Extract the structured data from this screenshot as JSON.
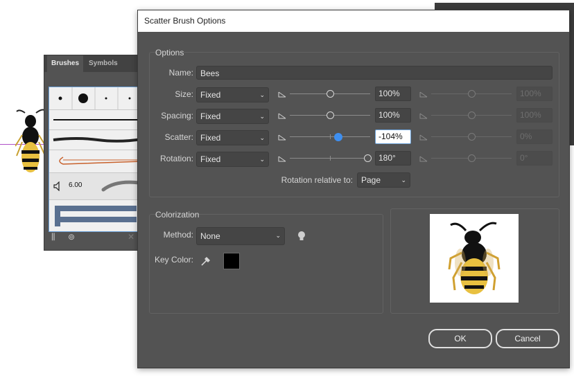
{
  "background": {
    "brushes_panel": {
      "tabs": [
        "Brushes",
        "Symbols"
      ],
      "stroke_weight": "6.00"
    }
  },
  "dialog": {
    "title": "Scatter Brush Options",
    "options_group": "Options",
    "name_label": "Name:",
    "name_value": "Bees",
    "rows": [
      {
        "label": "Size:",
        "method": "Fixed",
        "value": "100%",
        "value2": "100%",
        "slider_fraction": 0.5,
        "value2_dim": true
      },
      {
        "label": "Spacing:",
        "method": "Fixed",
        "value": "100%",
        "value2": "100%",
        "slider_fraction": 0.5,
        "value2_dim": true
      },
      {
        "label": "Scatter:",
        "method": "Fixed",
        "value": "-104%",
        "value2": "0%",
        "slider_fraction": 0.6,
        "value2_dim": true
      },
      {
        "label": "Rotation:",
        "method": "Fixed",
        "value": "180°",
        "value2": "0°",
        "slider_fraction": 1.0,
        "value2_dim": true
      }
    ],
    "rotation_relative_label": "Rotation relative to:",
    "rotation_relative_value": "Page",
    "colorization_group": "Colorization",
    "method_label": "Method:",
    "method_value": "None",
    "key_color_label": "Key Color:",
    "key_color": "#000000",
    "ok_label": "OK",
    "cancel_label": "Cancel"
  },
  "colors": {
    "dialog_bg": "#535353",
    "accent": "#3e8ff0"
  }
}
